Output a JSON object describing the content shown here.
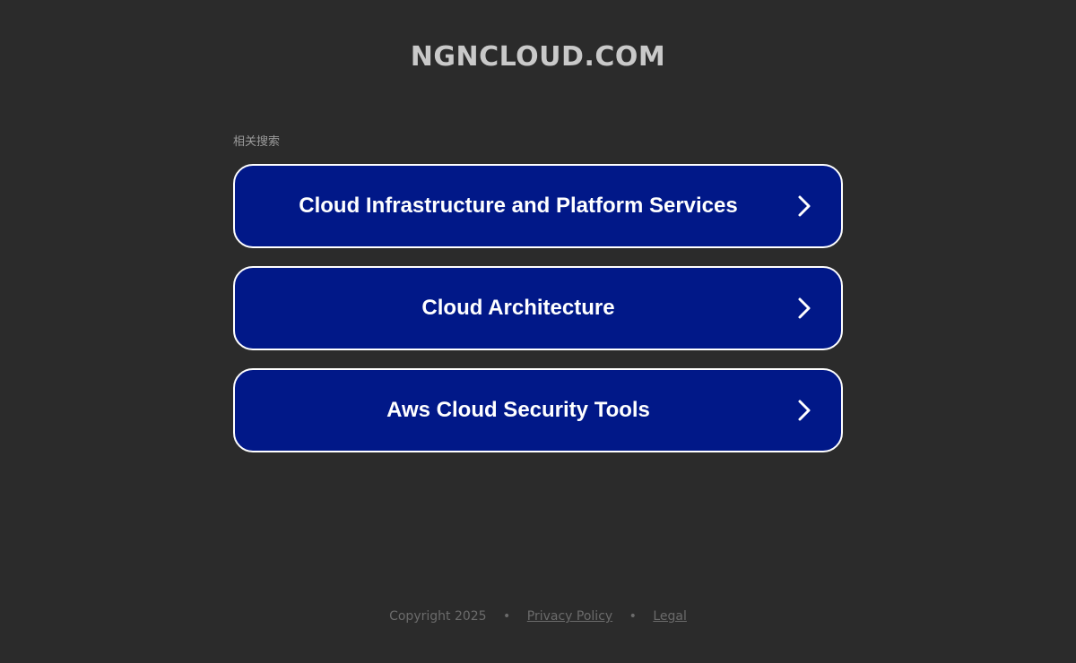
{
  "site": {
    "title": "NGNCLOUD.COM"
  },
  "related": {
    "label": "相关搜索",
    "items": [
      {
        "label": "Cloud Infrastructure and Platform Services",
        "icon": "chevron-right-icon"
      },
      {
        "label": "Cloud Architecture",
        "icon": "chevron-right-icon"
      },
      {
        "label": "Aws Cloud Security Tools",
        "icon": "chevron-right-icon"
      }
    ]
  },
  "footer": {
    "copyright": "Copyright 2025",
    "separator": "•",
    "privacy_label": "Privacy Policy",
    "legal_label": "Legal"
  },
  "colors": {
    "background": "#2b2b2b",
    "card_fill": "#011888",
    "card_border": "#ffffff",
    "title_text": "#c9c9c9",
    "footer_text": "#6b6b6b"
  }
}
